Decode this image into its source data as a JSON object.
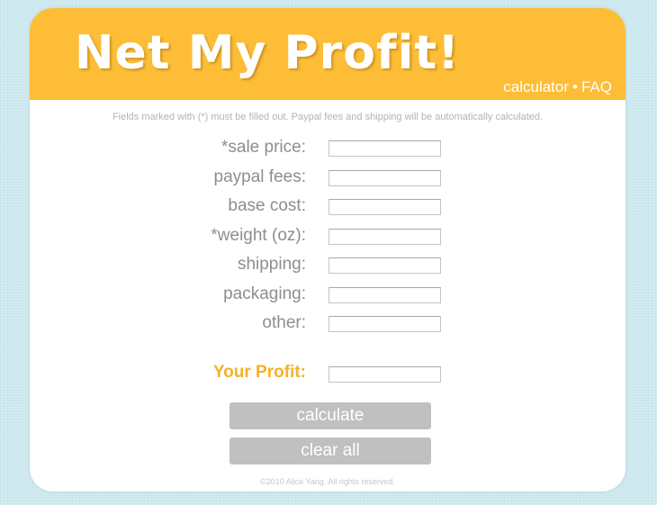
{
  "header": {
    "logo_text": "Net My Profit!",
    "nav": {
      "calculator": "calculator",
      "separator": "•",
      "faq": "FAQ"
    }
  },
  "form": {
    "note": "Fields marked with (*) must be filled out. Paypal fees and shipping will be automatically calculated.",
    "fields": {
      "sale_price": {
        "label": "*sale price:",
        "value": ""
      },
      "paypal_fees": {
        "label": "paypal fees:",
        "value": ""
      },
      "base_cost": {
        "label": "base cost:",
        "value": ""
      },
      "weight": {
        "label": "*weight (oz):",
        "value": ""
      },
      "shipping": {
        "label": "shipping:",
        "value": ""
      },
      "packaging": {
        "label": "packaging:",
        "value": ""
      },
      "other": {
        "label": "other:",
        "value": ""
      }
    },
    "profit": {
      "label": "Your Profit:",
      "value": ""
    },
    "buttons": {
      "calculate": "calculate",
      "clear_all": "clear all"
    }
  },
  "footer": {
    "copyright": "©2010 Alice Yang. All rights reserved."
  },
  "colors": {
    "header_bg": "#fdbd36",
    "profit_label": "#f5b128",
    "button_bg": "#c0c0c0",
    "page_bg": "#cde9ef"
  }
}
